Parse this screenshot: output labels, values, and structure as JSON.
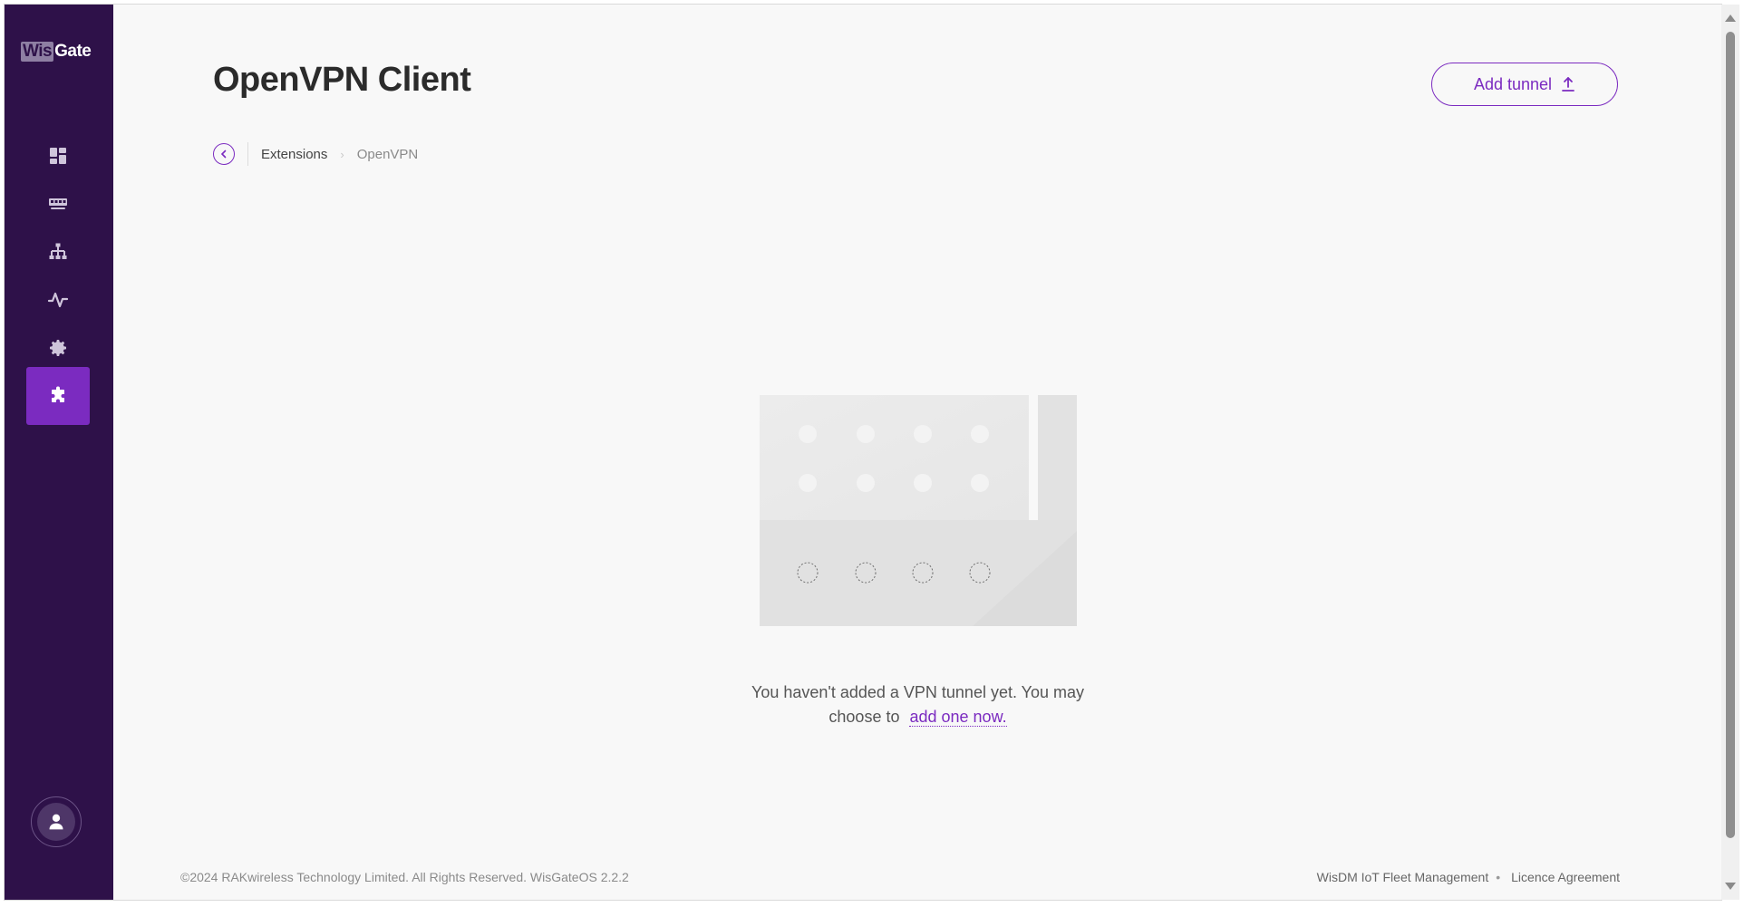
{
  "brand": {
    "logo_part1": "Wis",
    "logo_part2": "Gate"
  },
  "sidebar": {
    "items": [
      {
        "name": "dashboard",
        "icon": "dashboard-icon",
        "active": false
      },
      {
        "name": "gateway",
        "icon": "gateway-icon",
        "active": false
      },
      {
        "name": "network",
        "icon": "network-icon",
        "active": false
      },
      {
        "name": "activity",
        "icon": "activity-icon",
        "active": false
      },
      {
        "name": "settings",
        "icon": "gear-icon",
        "active": false
      },
      {
        "name": "extensions",
        "icon": "puzzle-icon",
        "active": true
      }
    ],
    "user_icon": "user-icon"
  },
  "header": {
    "title": "OpenVPN Client",
    "add_button_label": "Add tunnel",
    "add_button_icon": "upload-icon"
  },
  "breadcrumb": {
    "back_icon": "chevron-left-icon",
    "items": [
      "Extensions",
      "OpenVPN"
    ]
  },
  "empty_state": {
    "message": "You haven't added a VPN tunnel yet. You may choose to",
    "link_text": "add one now."
  },
  "footer": {
    "copyright": "©2024 RAKwireless Technology Limited. All Rights Reserved. WisGateOS 2.2.2",
    "link1": "WisDM IoT Fleet Management",
    "separator": "•",
    "link2": "Licence Agreement"
  },
  "colors": {
    "sidebar_bg": "#2e1149",
    "accent": "#7b2bc0",
    "page_bg": "#f8f8f8"
  }
}
